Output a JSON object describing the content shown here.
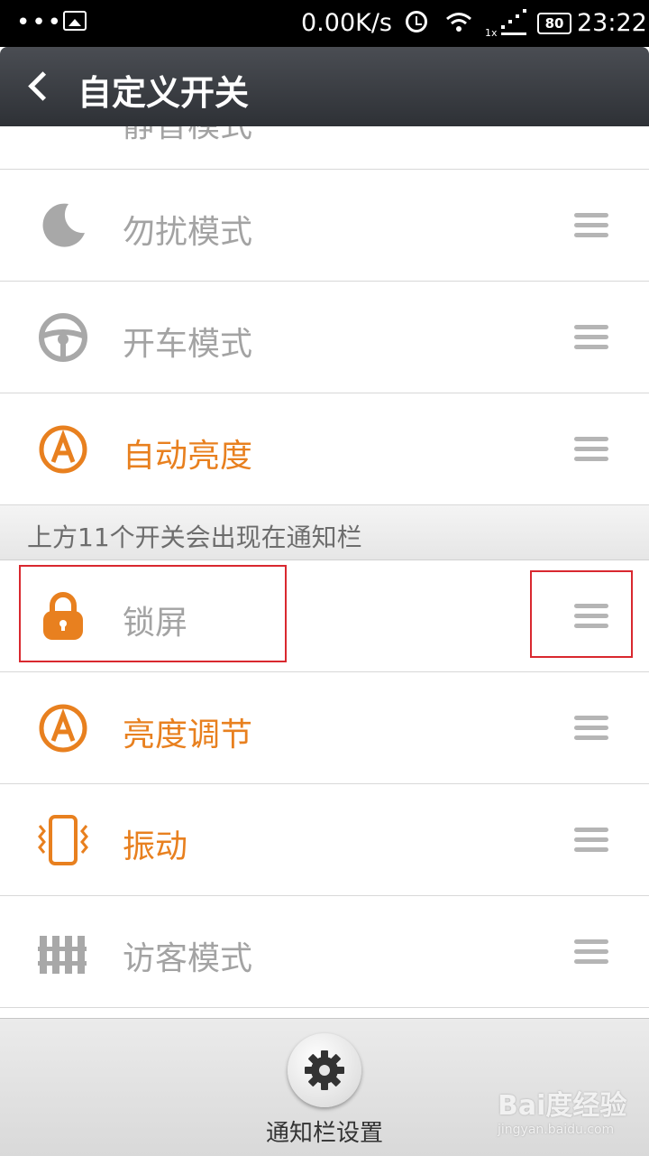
{
  "status_bar": {
    "dots": "•••",
    "speed": "0.00K/s",
    "network_type": "1x",
    "battery": "80",
    "time": "23:22"
  },
  "header": {
    "title": "自定义开关"
  },
  "list": {
    "partial_item": {
      "label": "静音模式"
    },
    "items_top": [
      {
        "label": "勿扰模式",
        "icon": "moon-icon",
        "active": false
      },
      {
        "label": "开车模式",
        "icon": "steering-wheel-icon",
        "active": false
      },
      {
        "label": "自动亮度",
        "icon": "auto-brightness-icon",
        "active": true
      }
    ],
    "section_header": "上方11个开关会出现在通知栏",
    "items_bottom": [
      {
        "label": "锁屏",
        "icon": "lock-icon",
        "active": false
      },
      {
        "label": "亮度调节",
        "icon": "brightness-icon",
        "active": true
      },
      {
        "label": "振动",
        "icon": "vibrate-icon",
        "active": true
      },
      {
        "label": "访客模式",
        "icon": "fence-icon",
        "active": false
      }
    ]
  },
  "bottom": {
    "label": "通知栏设置",
    "icon": "gear-icon"
  },
  "watermark": {
    "main": "Bai度经验",
    "sub": "jingyan.baidu.com"
  },
  "colors": {
    "accent": "#e8801f",
    "inactive": "#a3a3a3",
    "highlight": "#d9282f"
  }
}
